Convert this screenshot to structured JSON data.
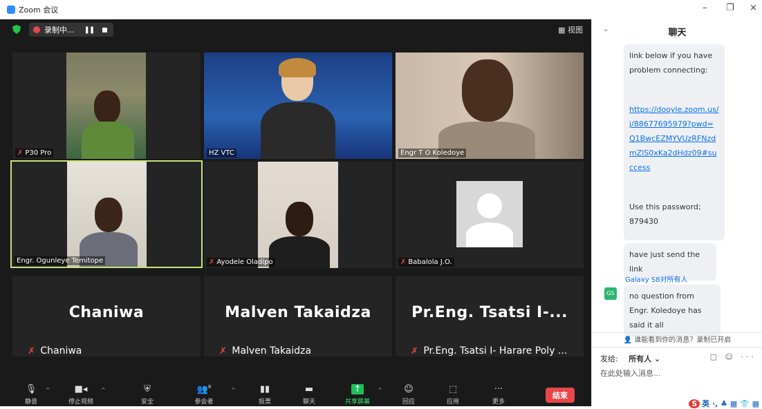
{
  "window": {
    "title": "Zoom 会议",
    "min": "–",
    "restore": "❐",
    "close": "×"
  },
  "topbar": {
    "recording": "录制中...",
    "pause": "❚❚",
    "view": "▦ 视图"
  },
  "tiles": [
    {
      "name": "P30 Pro",
      "muted": true
    },
    {
      "name": "HZ VTC",
      "muted": false
    },
    {
      "name": "Engr T O Koledoye",
      "muted": false
    },
    {
      "name": "Engr. Ogunleye Temitope",
      "muted": false,
      "active": true
    },
    {
      "name": "Ayodele Oladipo",
      "muted": true
    },
    {
      "name": "Babalola J.O.",
      "muted": true
    }
  ],
  "namecards": [
    {
      "display": "Chaniwa",
      "name": "Chaniwa"
    },
    {
      "display": "Malven Takaidza",
      "name": "Malven Takaidza"
    },
    {
      "display": "Pr.Eng. Tsatsi I-...",
      "name": "Pr.Eng. Tsatsi I- Harare Poly ..."
    }
  ],
  "toolbar": {
    "mute": "静音",
    "video": "停止视频",
    "security": "安全",
    "participants": "参会者",
    "participants_count": "8",
    "polls": "投票",
    "chat": "聊天",
    "share": "共享屏幕",
    "reactions": "回应",
    "apps": "应用",
    "more": "更多",
    "end": "结束"
  },
  "chat": {
    "title": "聊天",
    "msg1_pre": "link below if you have problem connecting:",
    "msg1_link": "https://dooyle.zoom.us/j/88677695979?pwd=Q1BwcEZMYVUzRFNzdmZlS0xKa2dHdz09#success",
    "msg1_post": "Use this password; 879430",
    "msg2": "have just send the link",
    "sender": "Galaxy S8对所有人",
    "avatar": "GS",
    "msg3": "no question from Engr. Koledoye has said it all",
    "notice": "谁能看到你的消息？录制已开启",
    "to_label": "发给:",
    "to_value": "所有人 ⌄",
    "placeholder": "在此处输入消息...",
    "tools": "▢ ☺ ···"
  },
  "ime": {
    "logo": "S",
    "text": "英 ·, ♣ ▦ 👕 ▦"
  }
}
